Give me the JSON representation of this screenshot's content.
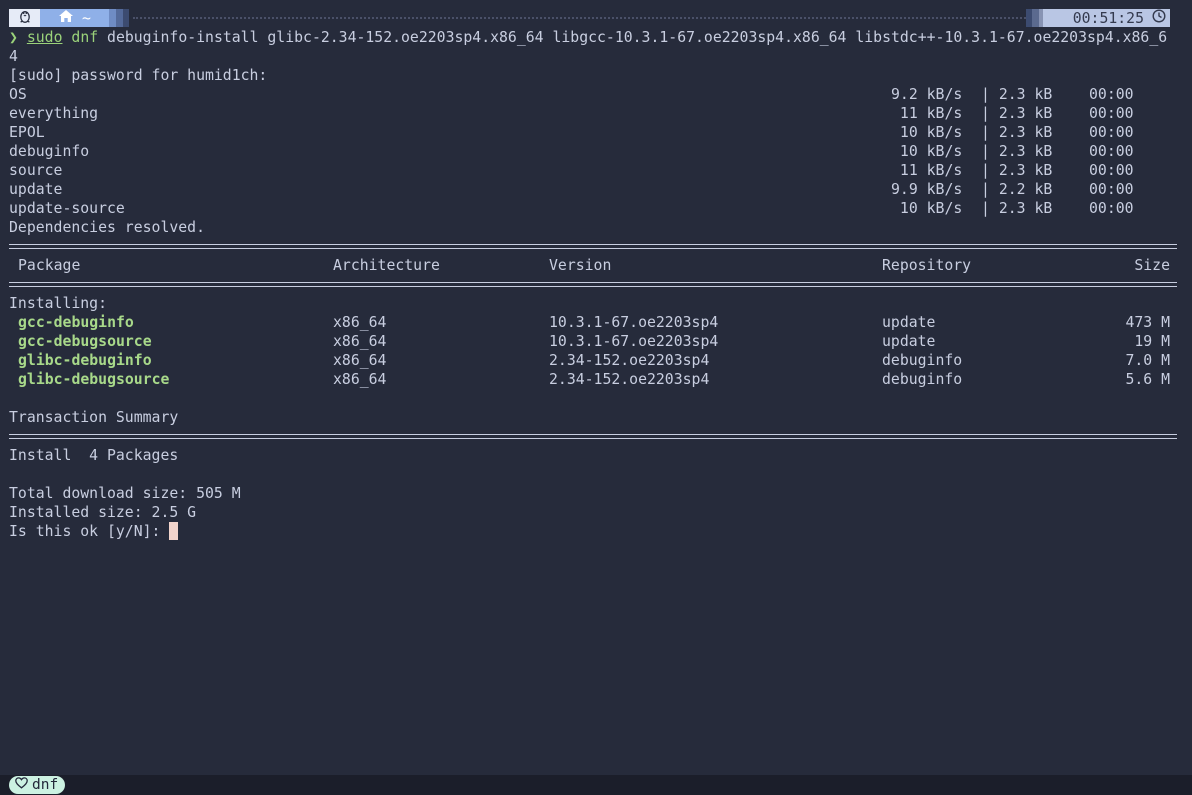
{
  "prompt": {
    "dir_label": "~",
    "time": "00:51:25",
    "os_icon": "linux-penguin-icon",
    "home_icon": "home-icon",
    "clock_icon": "clock-icon",
    "colors": {
      "os_bg": "#e6ebf7",
      "dir_bg": "#8fb0e8",
      "time_bg": "#b9c6e4",
      "chevron": "#9ad27a"
    }
  },
  "command": {
    "chevron": "❯",
    "sudo": "sudo",
    "dnf": "dnf",
    "args": " debuginfo-install glibc-2.34-152.oe2203sp4.x86_64 libgcc-10.3.1-67.oe2203sp4.x86_64 libstdc++-10.3.1-67.oe2203sp4.x86_6",
    "wrap": "4"
  },
  "password_prompt": "[sudo] password for humid1ch:",
  "repos": [
    {
      "name": "OS",
      "speed": "9.2 kB/s",
      "size": "2.3 kB",
      "time": "00:00"
    },
    {
      "name": "everything",
      "speed": " 11 kB/s",
      "size": "2.3 kB",
      "time": "00:00"
    },
    {
      "name": "EPOL",
      "speed": " 10 kB/s",
      "size": "2.3 kB",
      "time": "00:00"
    },
    {
      "name": "debuginfo",
      "speed": " 10 kB/s",
      "size": "2.3 kB",
      "time": "00:00"
    },
    {
      "name": "source",
      "speed": " 11 kB/s",
      "size": "2.3 kB",
      "time": "00:00"
    },
    {
      "name": "update",
      "speed": "9.9 kB/s",
      "size": "2.2 kB",
      "time": "00:00"
    },
    {
      "name": "update-source",
      "speed": " 10 kB/s",
      "size": "2.3 kB",
      "time": "00:00"
    }
  ],
  "deps_resolved": "Dependencies resolved.",
  "table": {
    "headers": {
      "package": "Package",
      "arch": "Architecture",
      "version": "Version",
      "repo": "Repository",
      "size": "Size"
    },
    "installing_label": "Installing:",
    "rows": [
      {
        "package": "gcc-debuginfo",
        "arch": "x86_64",
        "version": "10.3.1-67.oe2203sp4",
        "repo": "update",
        "size": "473 M"
      },
      {
        "package": "gcc-debugsource",
        "arch": "x86_64",
        "version": "10.3.1-67.oe2203sp4",
        "repo": "update",
        "size": "19 M"
      },
      {
        "package": "glibc-debuginfo",
        "arch": "x86_64",
        "version": "2.34-152.oe2203sp4",
        "repo": "debuginfo",
        "size": "7.0 M"
      },
      {
        "package": "glibc-debugsource",
        "arch": "x86_64",
        "version": "2.34-152.oe2203sp4",
        "repo": "debuginfo",
        "size": "5.6 M"
      }
    ]
  },
  "summary": {
    "title": "Transaction Summary",
    "install_line": "Install  4 Packages",
    "download_size": "Total download size: 505 M",
    "installed_size": "Installed size: 2.5 G",
    "confirm": "Is this ok [y/N]: "
  },
  "status_bar": {
    "icon": "heart-icon",
    "label": "dnf",
    "pill_color": "#ccf2e2"
  }
}
